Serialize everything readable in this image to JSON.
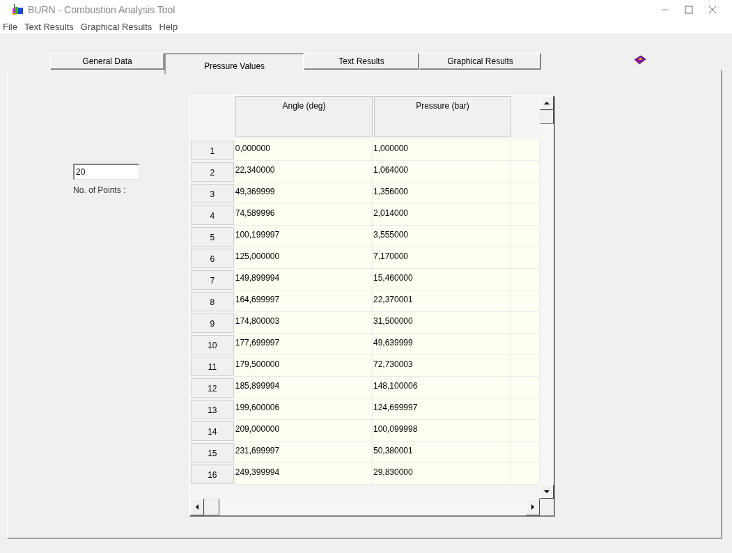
{
  "window": {
    "title": "BURN - Combustion Analysis Tool"
  },
  "menu": [
    "File",
    "Text Results",
    "Graphical Results",
    "Help"
  ],
  "tabs": [
    {
      "label": "General Data",
      "selected": false
    },
    {
      "label": "Pressure Values",
      "selected": true
    },
    {
      "label": "Text Results",
      "selected": false
    },
    {
      "label": "Graphical Results",
      "selected": false
    }
  ],
  "points": {
    "value": "20",
    "label": "No. of Points :"
  },
  "table": {
    "columns": [
      "Angle (deg)",
      "Pressure (bar)"
    ],
    "rows": [
      {
        "number": "1",
        "cells": [
          "0,000000",
          "1,000000"
        ]
      },
      {
        "number": "2",
        "cells": [
          "22,340000",
          "1,064000"
        ]
      },
      {
        "number": "3",
        "cells": [
          "49,369999",
          "1,356000"
        ]
      },
      {
        "number": "4",
        "cells": [
          "74,589996",
          "2,014000"
        ]
      },
      {
        "number": "5",
        "cells": [
          "100,199997",
          "3,555000"
        ]
      },
      {
        "number": "6",
        "cells": [
          "125,000000",
          "7,170000"
        ]
      },
      {
        "number": "7",
        "cells": [
          "149,899994",
          "15,460000"
        ]
      },
      {
        "number": "8",
        "cells": [
          "164,699997",
          "22,370001"
        ]
      },
      {
        "number": "9",
        "cells": [
          "174,800003",
          "31,500000"
        ]
      },
      {
        "number": "10",
        "cells": [
          "177,699997",
          "49,639999"
        ]
      },
      {
        "number": "11",
        "cells": [
          "179,500000",
          "72,730003"
        ]
      },
      {
        "number": "12",
        "cells": [
          "185,899994",
          "148,100006"
        ]
      },
      {
        "number": "13",
        "cells": [
          "199,600006",
          "124,699997"
        ]
      },
      {
        "number": "14",
        "cells": [
          "209,000000",
          "100,099998"
        ]
      },
      {
        "number": "15",
        "cells": [
          "231,699997",
          "50,380001"
        ]
      },
      {
        "number": "16",
        "cells": [
          "249,399994",
          "29,830000"
        ]
      }
    ]
  }
}
